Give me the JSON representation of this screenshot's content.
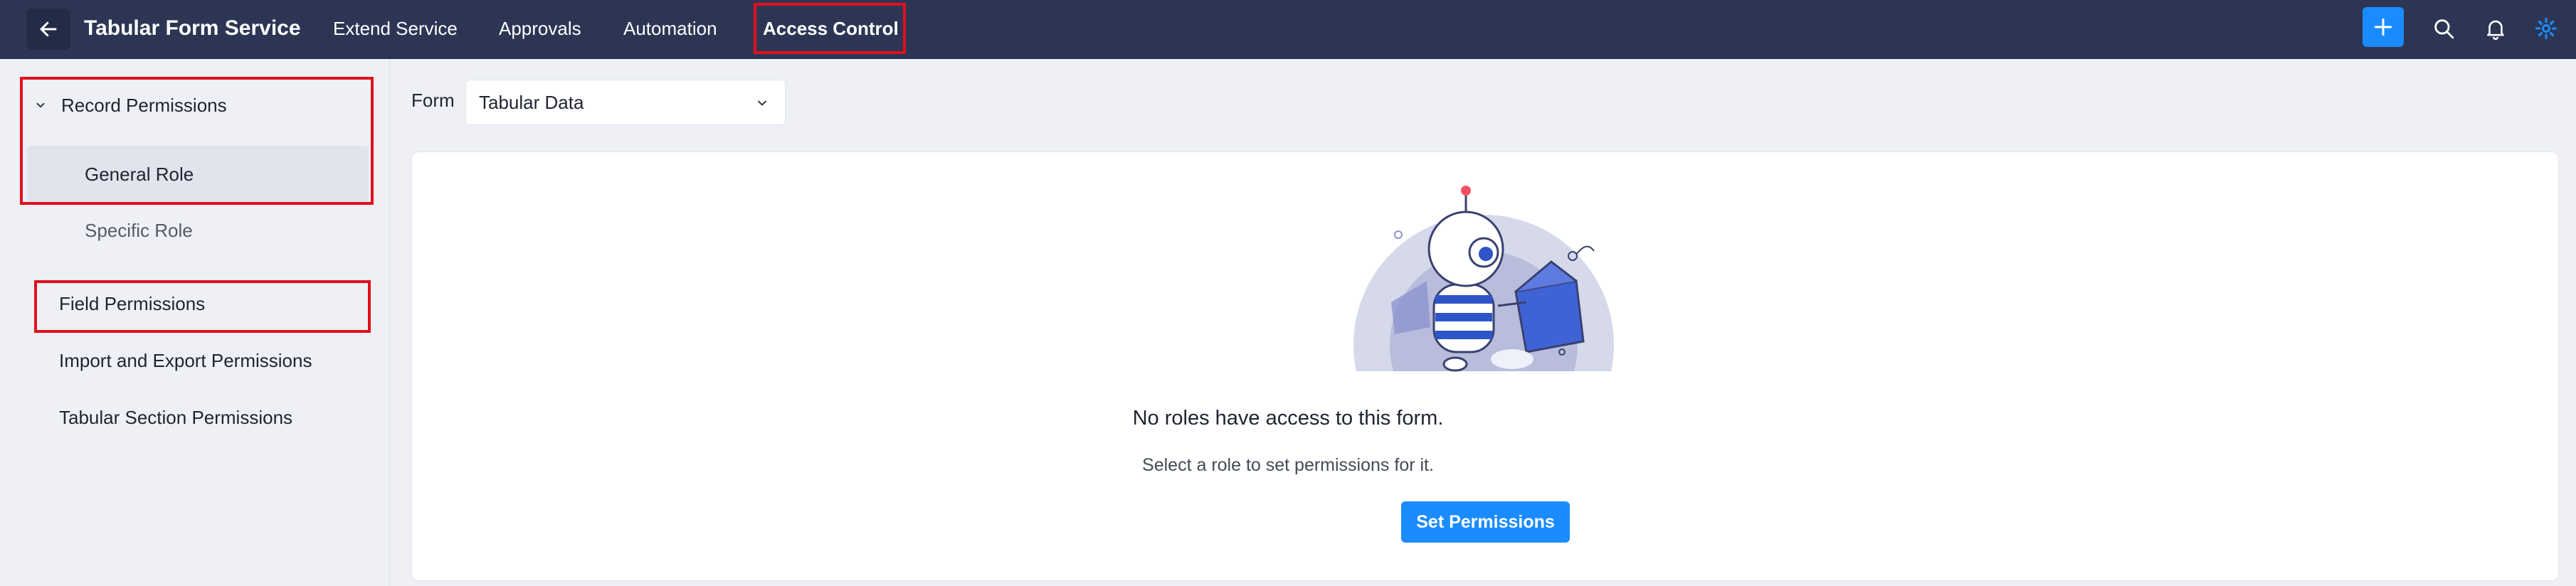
{
  "header": {
    "title": "Tabular Form Service",
    "nav": [
      {
        "label": "Extend Service"
      },
      {
        "label": "Approvals"
      },
      {
        "label": "Automation"
      },
      {
        "label": "Access Control"
      }
    ],
    "active_nav": "Access Control",
    "icons": [
      "back-arrow-icon",
      "plus-icon",
      "search-icon",
      "bell-icon",
      "gear-icon"
    ]
  },
  "sidebar": {
    "group": {
      "label": "Record Permissions",
      "expanded": true
    },
    "items": [
      {
        "label": "General Role"
      },
      {
        "label": "Specific Role"
      },
      {
        "label": "Field Permissions"
      },
      {
        "label": "Import and Export Permissions"
      },
      {
        "label": "Tabular Section Permissions"
      }
    ],
    "selected": "General Role"
  },
  "main": {
    "form_label": "Form",
    "form_value": "Tabular Data",
    "empty_title": "No roles have access to this form.",
    "empty_subtitle": "Select a role to set permissions for it.",
    "cta_label": "Set Permissions"
  },
  "colors": {
    "topbar": "#2c3654",
    "accent": "#1a8cff",
    "highlight_box": "#e0101e",
    "background": "#eef0f5"
  }
}
